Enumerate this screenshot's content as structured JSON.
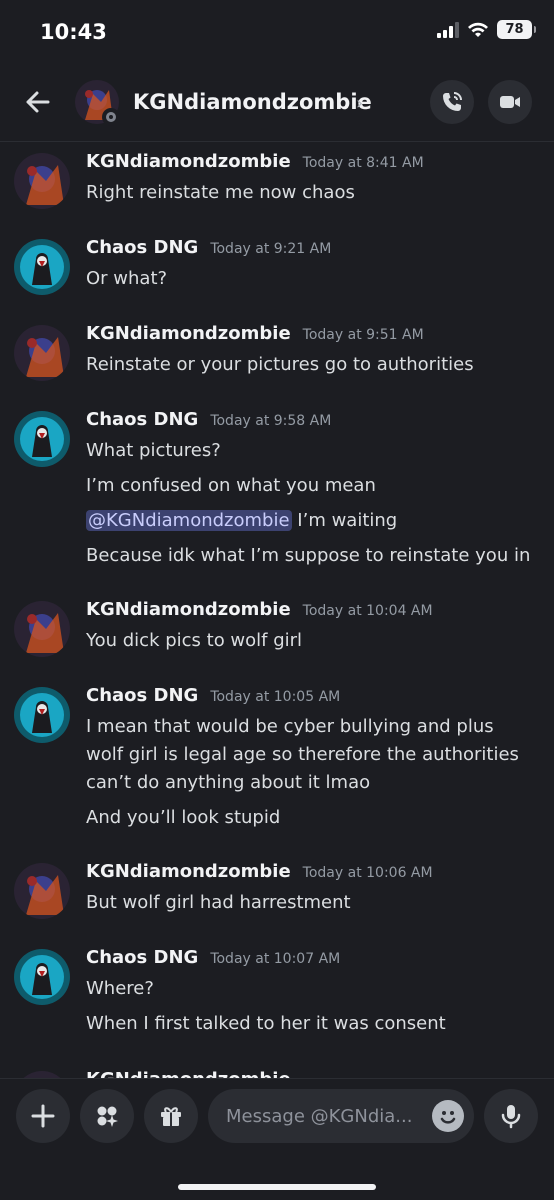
{
  "status_bar": {
    "time": "10:43",
    "battery": "78"
  },
  "header": {
    "title": "KGNdiamondzombie",
    "chevron": "›"
  },
  "messages": [
    {
      "author": "KGNdiamondzombie",
      "timestamp": "Today at 8:41 AM",
      "avatar": "kgn",
      "lines": [
        "Right reinstate me now chaos"
      ]
    },
    {
      "author": "Chaos DNG",
      "timestamp": "Today at 9:21 AM",
      "avatar": "chaos",
      "lines": [
        "Or what?"
      ]
    },
    {
      "author": "KGNdiamondzombie",
      "timestamp": "Today at 9:51 AM",
      "avatar": "kgn",
      "lines": [
        "Reinstate or your pictures go to authorities"
      ]
    },
    {
      "author": "Chaos DNG",
      "timestamp": "Today at 9:58 AM",
      "avatar": "chaos",
      "lines": [
        "What pictures?",
        "I’m confused on what you mean"
      ],
      "mention_line": {
        "mention": "@KGNdiamondzombie",
        "text": " I’m waiting"
      },
      "extra_lines": [
        "Because idk what I’m suppose to reinstate you in"
      ]
    },
    {
      "author": "KGNdiamondzombie",
      "timestamp": "Today at 10:04 AM",
      "avatar": "kgn",
      "lines": [
        "You dick pics to wolf girl"
      ]
    },
    {
      "author": "Chaos DNG",
      "timestamp": "Today at 10:05 AM",
      "avatar": "chaos",
      "lines": [
        "I mean that would be cyber bullying and plus wolf girl is legal age so therefore the authorities can’t do anything about it lmao",
        "And you’ll look stupid"
      ]
    },
    {
      "author": "KGNdiamondzombie",
      "timestamp": "Today at 10:06 AM",
      "avatar": "kgn",
      "lines": [
        "But wolf girl had harrestment"
      ]
    },
    {
      "author": "Chaos DNG",
      "timestamp": "Today at 10:07 AM",
      "avatar": "chaos",
      "lines": [
        "Where?",
        "When I first talked to her it was consent"
      ]
    },
    {
      "author": "KGNdiamondzombie",
      "timestamp": "",
      "avatar": "kgn",
      "lines": []
    }
  ],
  "composer": {
    "placeholder": "Message @KGNdia..."
  },
  "icons": {
    "back": "back-arrow-icon",
    "call": "phone-call-icon",
    "video": "video-camera-icon",
    "plus": "plus-icon",
    "apps": "apps-icon",
    "gift": "gift-icon",
    "emoji": "emoji-icon",
    "mic": "microphone-icon"
  },
  "colors": {
    "background": "#1c1d22",
    "surface": "#2b2d33",
    "mention_bg": "#3c4270",
    "timestamp": "#949ba4"
  }
}
